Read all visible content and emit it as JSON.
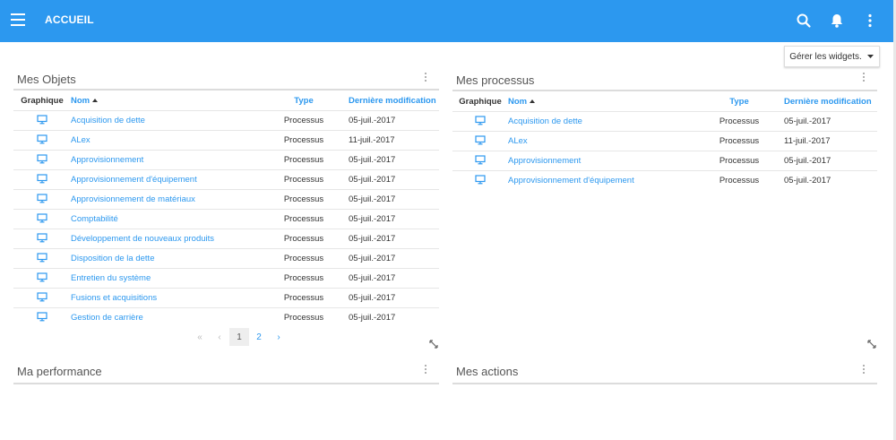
{
  "app": {
    "title": "ACCUEIL"
  },
  "toolbar": {
    "manage_widgets_label": "Gérer les widgets."
  },
  "columns": {
    "graphic": "Graphique",
    "name": "Nom",
    "type": "Type",
    "modified": "Dernière modification"
  },
  "mes_objets": {
    "title": "Mes Objets",
    "rows": [
      {
        "name": "Acquisition de dette",
        "type": "Processus",
        "date": "05-juil.-2017"
      },
      {
        "name": "ALex",
        "type": "Processus",
        "date": "11-juil.-2017"
      },
      {
        "name": "Approvisionnement",
        "type": "Processus",
        "date": "05-juil.-2017"
      },
      {
        "name": "Approvisionnement d'équipement",
        "type": "Processus",
        "date": "05-juil.-2017"
      },
      {
        "name": "Approvisionnement de matériaux",
        "type": "Processus",
        "date": "05-juil.-2017"
      },
      {
        "name": "Comptabilité",
        "type": "Processus",
        "date": "05-juil.-2017"
      },
      {
        "name": "Développement de nouveaux produits",
        "type": "Processus",
        "date": "05-juil.-2017"
      },
      {
        "name": "Disposition de la dette",
        "type": "Processus",
        "date": "05-juil.-2017"
      },
      {
        "name": "Entretien du système",
        "type": "Processus",
        "date": "05-juil.-2017"
      },
      {
        "name": "Fusions et acquisitions",
        "type": "Processus",
        "date": "05-juil.-2017"
      },
      {
        "name": "Gestion de carrière",
        "type": "Processus",
        "date": "05-juil.-2017"
      }
    ],
    "pagination": {
      "first": "«",
      "prev": "‹",
      "pages": [
        "1",
        "2"
      ],
      "next": "›",
      "current_page": 1
    }
  },
  "mes_processus": {
    "title": "Mes processus",
    "rows": [
      {
        "name": "Acquisition de dette",
        "type": "Processus",
        "date": "05-juil.-2017"
      },
      {
        "name": "ALex",
        "type": "Processus",
        "date": "11-juil.-2017"
      },
      {
        "name": "Approvisionnement",
        "type": "Processus",
        "date": "05-juil.-2017"
      },
      {
        "name": "Approvisionnement d'équipement",
        "type": "Processus",
        "date": "05-juil.-2017"
      }
    ]
  },
  "ma_performance": {
    "title": "Ma performance"
  },
  "mes_actions": {
    "title": "Mes actions"
  },
  "icons": {
    "menu": "menu-icon",
    "search": "search-icon",
    "bell": "bell-icon",
    "more": "more-vert-icon",
    "row_graphic": "monitor-icon",
    "sort": "sort-ascending-icon",
    "expand": "expand-icon"
  },
  "colors": {
    "primary": "#2c98ef",
    "text": "#333333",
    "title": "#555555",
    "divider": "#dcdcdc"
  }
}
